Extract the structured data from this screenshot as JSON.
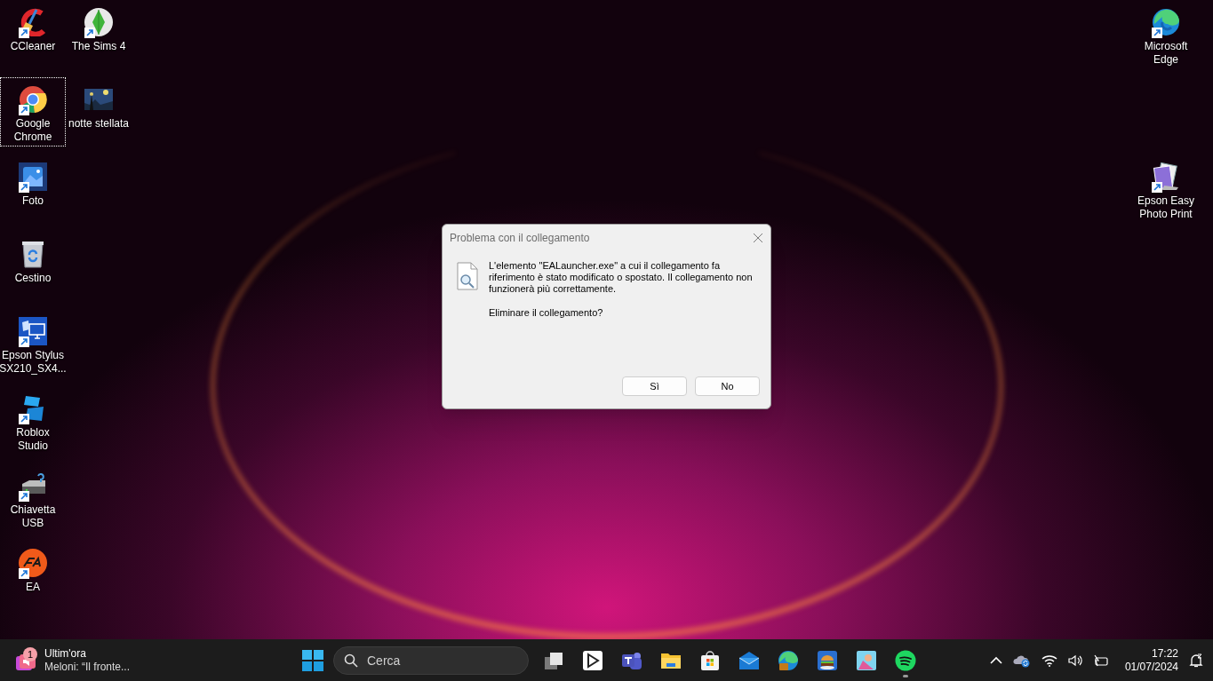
{
  "desktop": {
    "icons": [
      {
        "label": "CCleaner",
        "kind": "ccleaner",
        "shortcut": true,
        "selected": false
      },
      {
        "label": "The Sims 4",
        "kind": "sims",
        "shortcut": true,
        "selected": false
      },
      {
        "label": "Google Chrome",
        "kind": "chrome",
        "shortcut": true,
        "selected": true
      },
      {
        "label": "notte stellata",
        "kind": "painting",
        "shortcut": false,
        "selected": false
      },
      {
        "label": "Foto",
        "kind": "photos",
        "shortcut": true,
        "selected": false
      },
      {
        "label": "Cestino",
        "kind": "recycle",
        "shortcut": false,
        "selected": false
      },
      {
        "label": "Epson Stylus SX210_SX4...",
        "kind": "monitor-app",
        "shortcut": true,
        "selected": false
      },
      {
        "label": "Roblox Studio",
        "kind": "roblox",
        "shortcut": true,
        "selected": false
      },
      {
        "label": "Chiavetta USB",
        "kind": "drive",
        "shortcut": true,
        "selected": false
      },
      {
        "label": "EA",
        "kind": "ea",
        "shortcut": true,
        "selected": false
      },
      {
        "label": "Microsoft Edge",
        "kind": "edge",
        "shortcut": true,
        "selected": false
      },
      {
        "label": "Epson Easy Photo Print",
        "kind": "photo-stack",
        "shortcut": true,
        "selected": false
      }
    ]
  },
  "dialog": {
    "title": "Problema con il collegamento",
    "message": "L'elemento \"EALauncher.exe\" a cui il collegamento fa riferimento è stato modificato o spostato. Il collegamento non funzionerà più correttamente.",
    "question": "Eliminare il collegamento?",
    "buttons": [
      "Sì",
      "No"
    ]
  },
  "taskbar": {
    "news": {
      "badge": "1",
      "title": "Ultim'ora",
      "subtitle": "Meloni: “Il fronte..."
    },
    "search": {
      "placeholder": "Cerca"
    },
    "apps": [
      {
        "kind": "task-view",
        "running": false
      },
      {
        "kind": "media-player",
        "running": false
      },
      {
        "kind": "teams",
        "running": false
      },
      {
        "kind": "folder",
        "running": false
      },
      {
        "kind": "store",
        "running": false
      },
      {
        "kind": "mail",
        "running": false
      },
      {
        "kind": "edge",
        "running": false
      },
      {
        "kind": "burger",
        "running": false
      },
      {
        "kind": "game",
        "running": false
      },
      {
        "kind": "spotify",
        "running": true
      }
    ],
    "time": "17:22",
    "date": "01/07/2024"
  }
}
